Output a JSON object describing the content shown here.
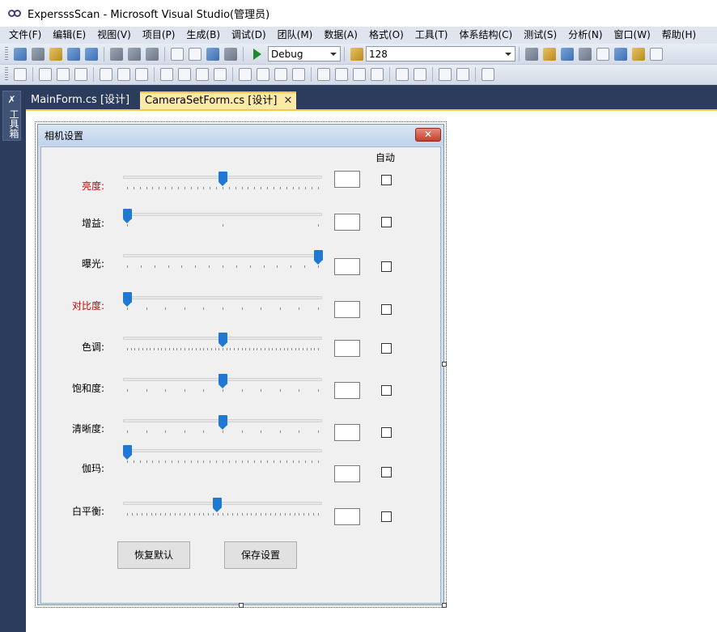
{
  "app": {
    "title": "ExpersssScan - Microsoft Visual Studio(管理员)"
  },
  "menu": [
    "文件(F)",
    "编辑(E)",
    "视图(V)",
    "项目(P)",
    "生成(B)",
    "调试(D)",
    "团队(M)",
    "数据(A)",
    "格式(O)",
    "工具(T)",
    "体系结构(C)",
    "测试(S)",
    "分析(N)",
    "窗口(W)",
    "帮助(H)"
  ],
  "toolbar": {
    "config": "Debug",
    "value": "128"
  },
  "toolbox": {
    "label": "工具箱"
  },
  "tabs": [
    {
      "label": "MainForm.cs [设计]"
    },
    {
      "label": "CameraSetForm.cs [设计]",
      "close": "✕"
    }
  ],
  "form": {
    "title": "相机设置",
    "close": "✕",
    "auto_header": "自动",
    "rows": [
      {
        "label": "亮度:",
        "position": 0.5,
        "ticks": 30,
        "red": true
      },
      {
        "label": "增益:",
        "position": 0.0,
        "ticks": 2,
        "red": false
      },
      {
        "label": "曝光:",
        "position": 1.0,
        "ticks": 14,
        "red": false
      },
      {
        "label": "对比度:",
        "position": 0.0,
        "ticks": 10,
        "red": true
      },
      {
        "label": "色调:",
        "position": 0.5,
        "ticks": 50,
        "red": false
      },
      {
        "label": "饱和度:",
        "position": 0.5,
        "ticks": 10,
        "red": false
      },
      {
        "label": "清晰度:",
        "position": 0.5,
        "ticks": 10,
        "red": false
      },
      {
        "label": "伽玛:",
        "position": 0.0,
        "ticks": 30,
        "red": false
      },
      {
        "label": "白平衡:",
        "position": 0.47,
        "ticks": 40,
        "red": false
      }
    ],
    "buttons": {
      "restore": "恢复默认",
      "save": "保存设置"
    }
  }
}
